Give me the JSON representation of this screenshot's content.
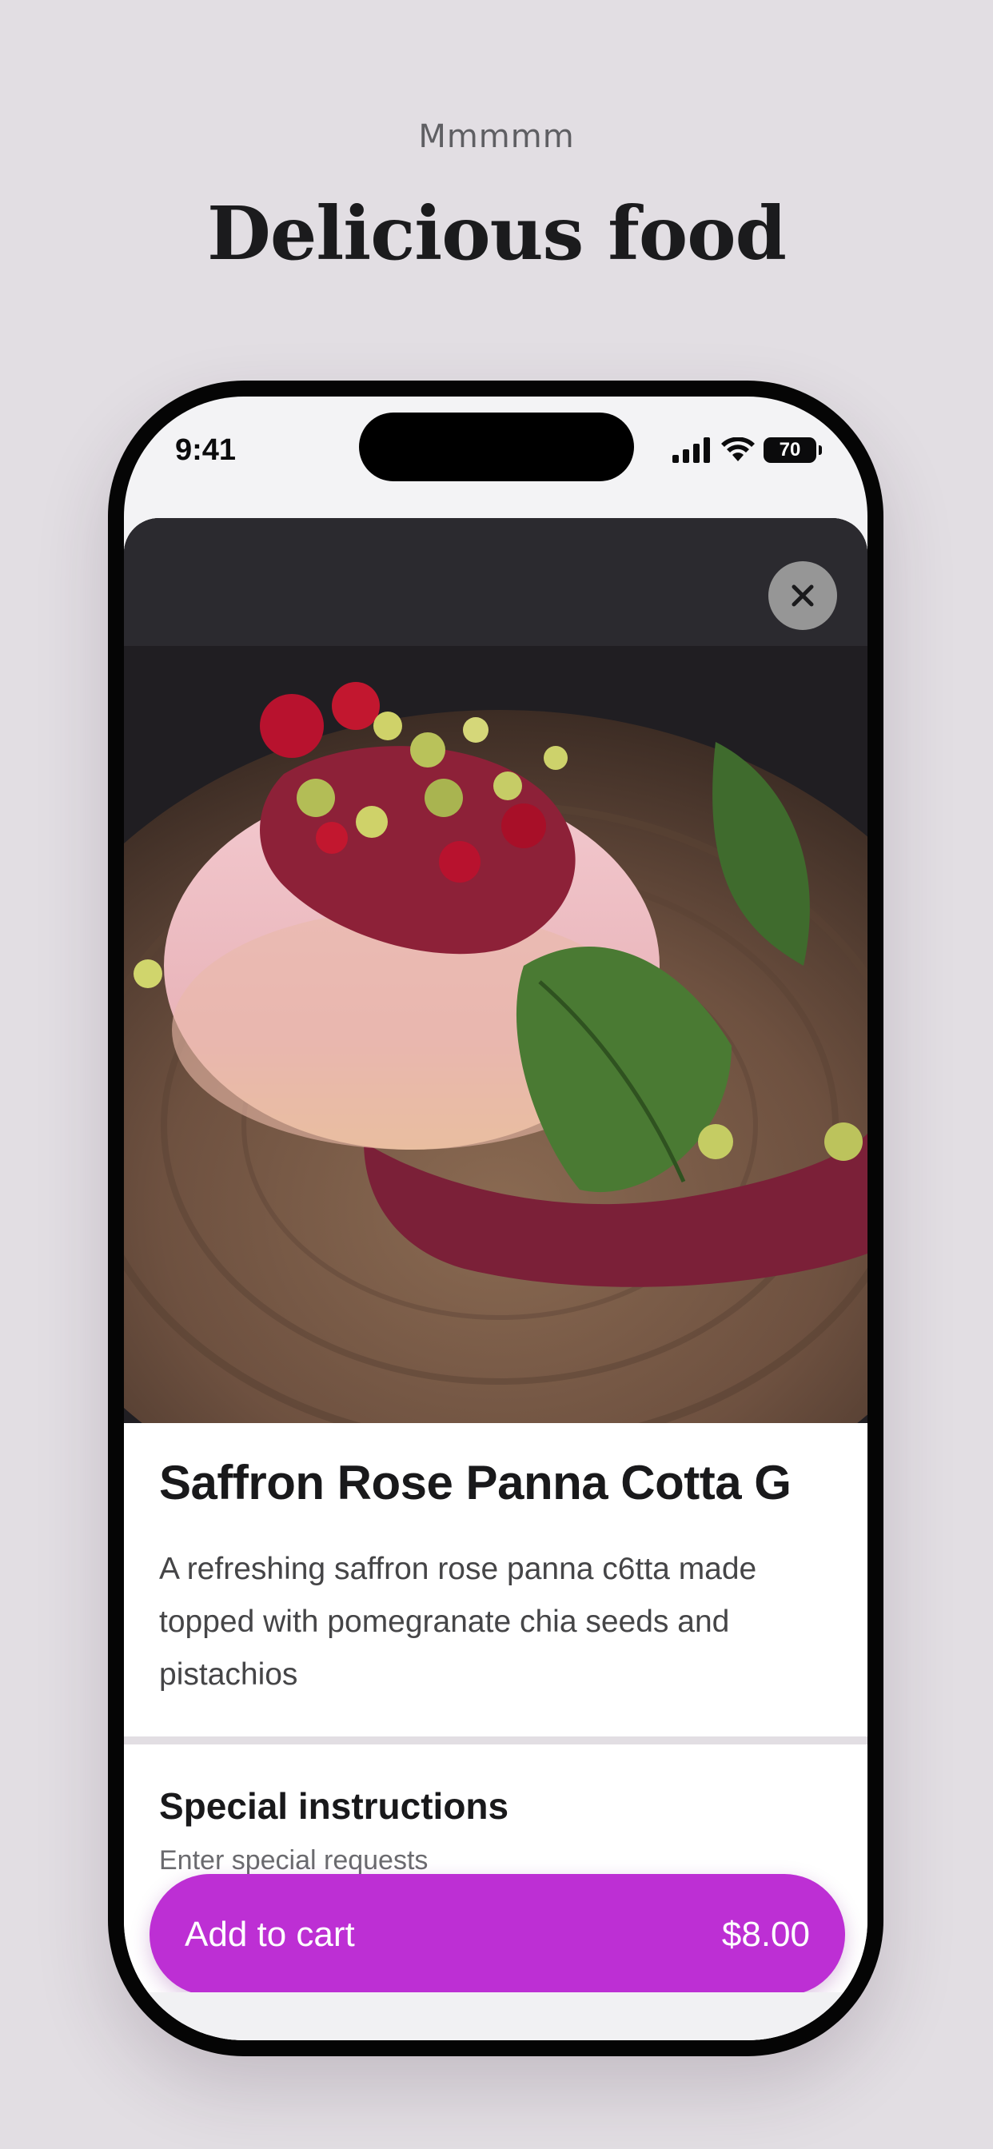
{
  "page": {
    "eyebrow": "Mmmmm",
    "headline": "Delicious food"
  },
  "status_bar": {
    "time": "9:41",
    "battery": "70",
    "icons": [
      "signal-icon",
      "wifi-icon",
      "battery-icon"
    ]
  },
  "dish": {
    "image_icon": "food-photo",
    "title": "Saffron Rose Panna Cotta G",
    "description": "A refreshing saffron rose panna c6tta made topped with pomegranate chia seeds and pistachios"
  },
  "special_instructions": {
    "heading": "Special instructions",
    "placeholder": "Enter special requests"
  },
  "cart": {
    "label": "Add to cart",
    "price": "$8.00"
  },
  "colors": {
    "background": "#e2dee3",
    "accent": "#bd2fd4",
    "text": "#19191b"
  }
}
